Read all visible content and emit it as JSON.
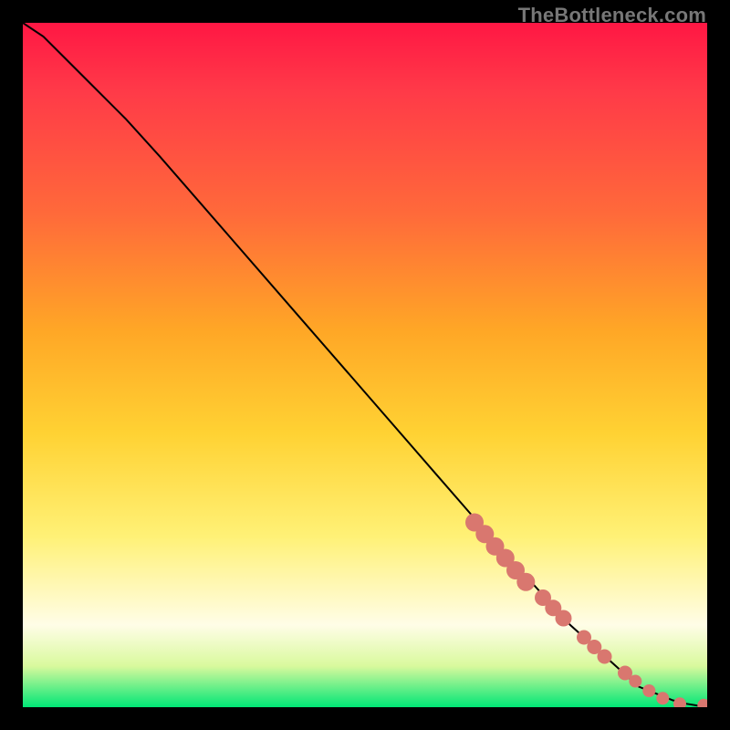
{
  "attribution": "TheBottleneck.com",
  "chart_data": {
    "type": "scatter",
    "title": "",
    "xlabel": "",
    "ylabel": "",
    "xlim": [
      0,
      100
    ],
    "ylim": [
      0,
      100
    ],
    "grid": false,
    "legend": false,
    "line_series": {
      "name": "curve",
      "x": [
        0,
        3,
        6,
        10,
        15,
        20,
        30,
        40,
        50,
        60,
        70,
        80,
        90,
        95,
        97,
        100
      ],
      "y": [
        100,
        98,
        95,
        91,
        86,
        80.5,
        69,
        57.5,
        46,
        34.5,
        23,
        12,
        3,
        1,
        0.5,
        0
      ]
    },
    "point_series": {
      "name": "points",
      "color": "#d9776f",
      "radius_base": 9,
      "points": [
        {
          "x": 66,
          "y": 27,
          "r": 10
        },
        {
          "x": 67.5,
          "y": 25.3,
          "r": 10
        },
        {
          "x": 69,
          "y": 23.5,
          "r": 10
        },
        {
          "x": 70.5,
          "y": 21.8,
          "r": 10
        },
        {
          "x": 72,
          "y": 20.0,
          "r": 10
        },
        {
          "x": 73.5,
          "y": 18.3,
          "r": 10
        },
        {
          "x": 76,
          "y": 16.0,
          "r": 9
        },
        {
          "x": 77.5,
          "y": 14.5,
          "r": 9
        },
        {
          "x": 79,
          "y": 13.0,
          "r": 9
        },
        {
          "x": 82,
          "y": 10.2,
          "r": 8
        },
        {
          "x": 83.5,
          "y": 8.8,
          "r": 8
        },
        {
          "x": 85,
          "y": 7.4,
          "r": 8
        },
        {
          "x": 88,
          "y": 5.0,
          "r": 8
        },
        {
          "x": 89.5,
          "y": 3.8,
          "r": 7
        },
        {
          "x": 91.5,
          "y": 2.4,
          "r": 7
        },
        {
          "x": 93.5,
          "y": 1.3,
          "r": 7
        },
        {
          "x": 96,
          "y": 0.5,
          "r": 7
        },
        {
          "x": 99.5,
          "y": 0.3,
          "r": 7
        }
      ]
    }
  }
}
